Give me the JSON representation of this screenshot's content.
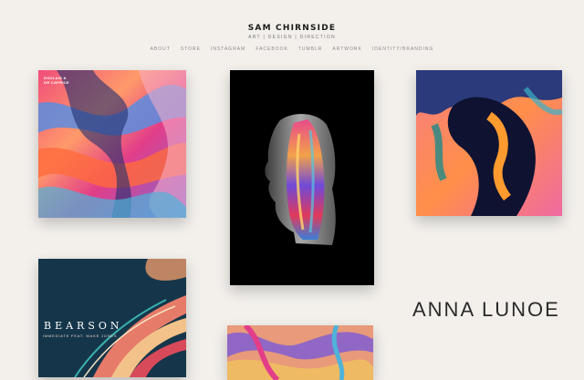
{
  "header": {
    "title": "SAM CHIRNSIDE",
    "tagline": "ART | DESIGN | DIRECTION"
  },
  "nav": {
    "items": [
      "ABOUT",
      "STORE",
      "INSTAGRAM",
      "FACEBOOK",
      "TUMBLR",
      "ARTWORK",
      "IDENTITY/BRANDING"
    ]
  },
  "tiles": {
    "cover1": {
      "line1": "DOULAIS &",
      "line2": "DR CAPRICE"
    },
    "cover4": {
      "title": "BEARSON",
      "subtitle": "IMMEDIATE FEAT. MAKE JONES"
    },
    "logo": "ANNA LUNOE"
  },
  "colors": {
    "background": "#f3f0ec",
    "text": "#1b1b1b",
    "nav": "#8a8a8a"
  }
}
